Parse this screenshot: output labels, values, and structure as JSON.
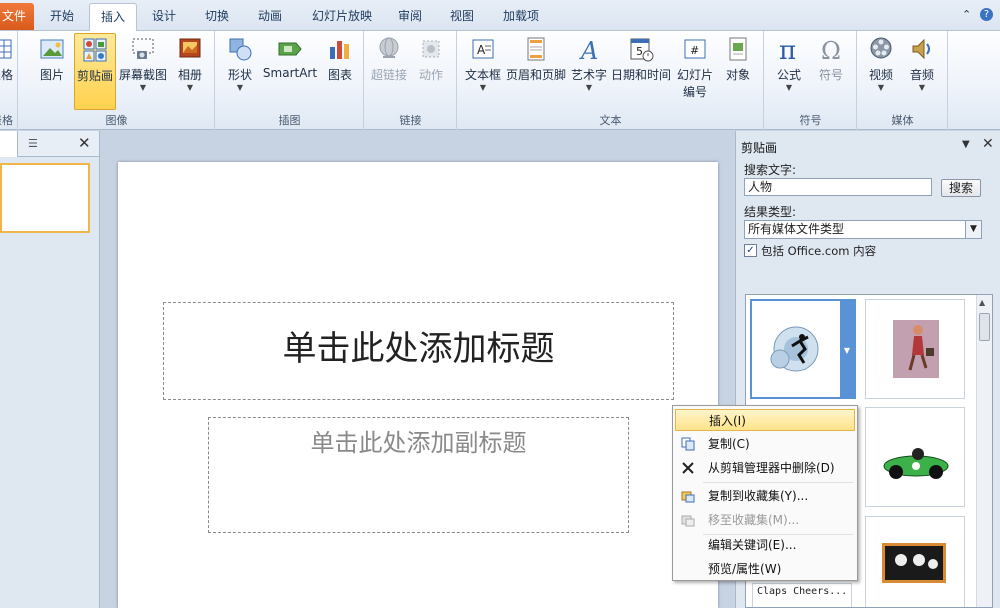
{
  "tabs": {
    "file": "文件",
    "items": [
      "开始",
      "插入",
      "设计",
      "切换",
      "动画",
      "幻灯片放映",
      "审阅",
      "视图",
      "加载项"
    ],
    "active": "插入"
  },
  "window_controls": {
    "minimize": "⌃",
    "help": "?"
  },
  "ribbon": {
    "table_group": {
      "label": "表格",
      "btn": "表格"
    },
    "image_group": {
      "label": "图像",
      "picture": "图片",
      "clipart": "剪贴画",
      "screenshot": "屏幕截图",
      "album": "相册"
    },
    "illustration_group": {
      "label": "插图",
      "shapes": "形状",
      "smartart": "SmartArt",
      "chart": "图表"
    },
    "links_group": {
      "label": "链接",
      "hyperlink": "超链接",
      "action": "动作"
    },
    "text_group": {
      "label": "文本",
      "textbox": "文本框",
      "header_footer": "页眉和页脚",
      "wordart": "艺术字",
      "datetime": "日期和时间",
      "slide_number_1": "幻灯片",
      "slide_number_2": "编号",
      "object": "对象"
    },
    "symbols_group": {
      "label": "符号",
      "equation": "公式",
      "symbol": "符号"
    },
    "media_group": {
      "label": "媒体",
      "video": "视频",
      "audio": "音频"
    }
  },
  "slide": {
    "title_placeholder": "单击此处添加标题",
    "subtitle_placeholder": "单击此处添加副标题"
  },
  "clipart_pane": {
    "title": "剪贴画",
    "search_label": "搜索文字:",
    "search_value": "人物",
    "search_button": "搜索",
    "result_type_label": "结果类型:",
    "result_type_value": "所有媒体文件类型",
    "include_office": "包括 Office.com 内容",
    "include_checked": true,
    "clip_caption": "Claps Cheers..."
  },
  "context_menu": {
    "items": [
      {
        "label": "插入(I)",
        "icon": "none",
        "disabled": false,
        "highlighted": true
      },
      {
        "label": "复制(C)",
        "icon": "copy-icon",
        "disabled": false,
        "highlighted": false
      },
      {
        "label": "从剪辑管理器中删除(D)",
        "icon": "delete-x-icon",
        "disabled": false,
        "highlighted": false
      },
      {
        "label": "复制到收藏集(Y)...",
        "icon": "copy-collection-icon",
        "disabled": false,
        "highlighted": false
      },
      {
        "label": "移至收藏集(M)...",
        "icon": "move-collection-icon",
        "disabled": true,
        "highlighted": false
      },
      {
        "label": "编辑关键词(E)...",
        "icon": "none",
        "disabled": false,
        "highlighted": false
      },
      {
        "label": "预览/属性(W)",
        "icon": "none",
        "disabled": false,
        "highlighted": false
      }
    ]
  },
  "colors": {
    "accent": "#f07a3a",
    "active_button": "#ffd24f",
    "pane_bg": "#dfe7f1"
  }
}
